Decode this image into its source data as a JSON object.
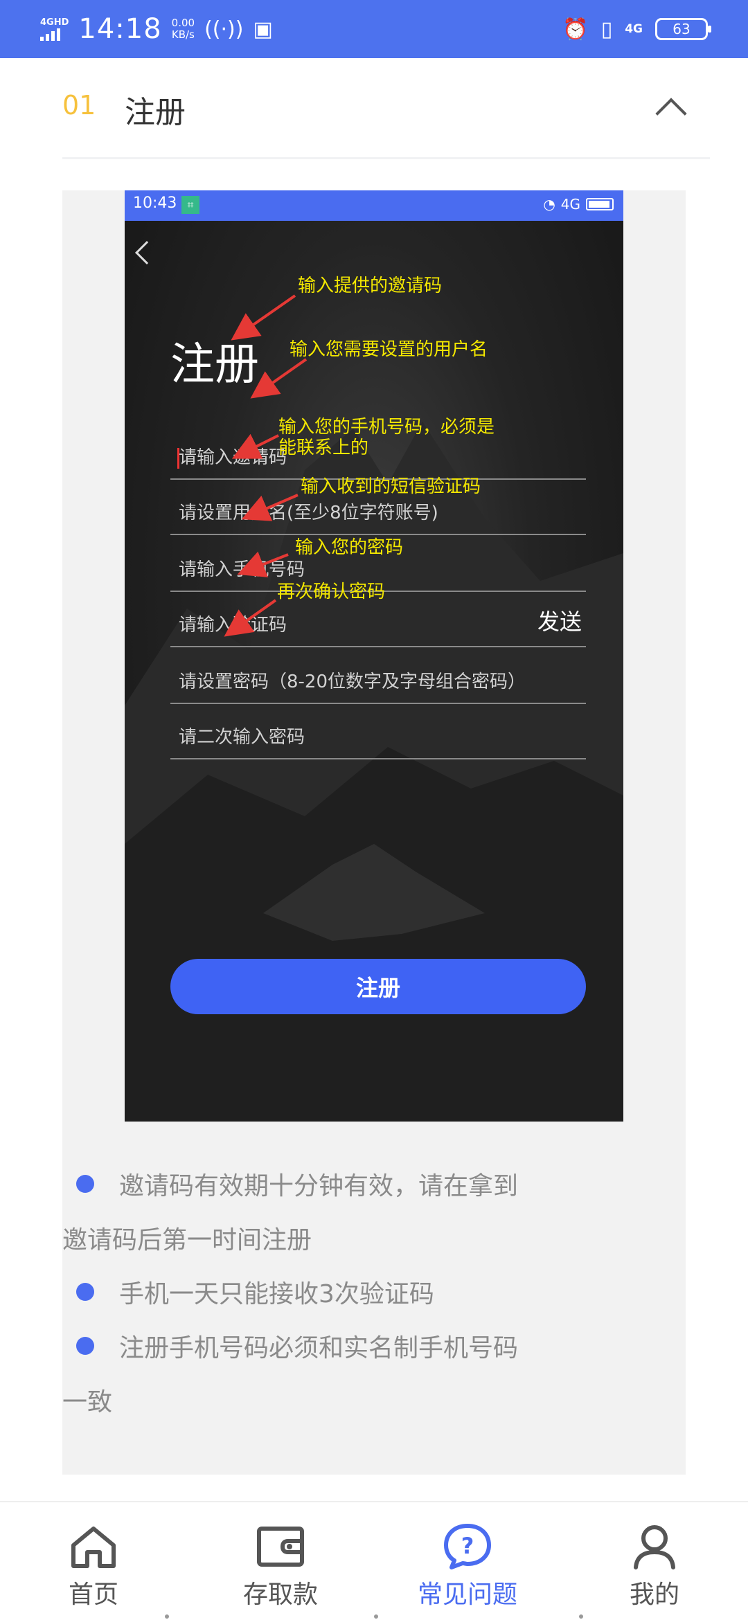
{
  "status_bar": {
    "network": "4GHD",
    "time": "14:18",
    "speed_value": "0.00",
    "speed_unit": "KB/s",
    "network_right": "4G",
    "battery": "63"
  },
  "section": {
    "number": "01",
    "title": "注册"
  },
  "screenshot": {
    "status_time": "10:43",
    "status_network": "4G",
    "title": "注册",
    "fields": [
      {
        "placeholder": "请输入邀请码"
      },
      {
        "placeholder": "请设置用户名(至少8位字符账号)"
      },
      {
        "placeholder": "请输入手机号码"
      },
      {
        "placeholder": "请输入验证码",
        "action": "发送"
      },
      {
        "placeholder": "请设置密码（8-20位数字及字母组合密码）"
      },
      {
        "placeholder": "请二次输入密码"
      }
    ],
    "annotations": [
      "输入提供的邀请码",
      "输入您需要设置的用户名",
      "输入您的手机号码，必须是",
      "能联系上的",
      "输入收到的短信验证码",
      "输入您的密码",
      "再次确认密码"
    ],
    "button": "注册"
  },
  "tips": [
    "邀请码有效期十分钟有效，请在拿到",
    "邀请码后第一时间注册",
    "手机一天只能接收3次验证码",
    "注册手机号码必须和实名制手机号码",
    "一致"
  ],
  "bottom_nav": {
    "items": [
      {
        "label": "首页",
        "icon": "home-icon"
      },
      {
        "label": "存取款",
        "icon": "wallet-icon"
      },
      {
        "label": "常见问题",
        "icon": "question-icon",
        "active": true
      },
      {
        "label": "我的",
        "icon": "user-icon"
      }
    ]
  },
  "colors": {
    "accent": "#4a6cf0",
    "number": "#f6c13c",
    "annotation": "#f4e800"
  }
}
